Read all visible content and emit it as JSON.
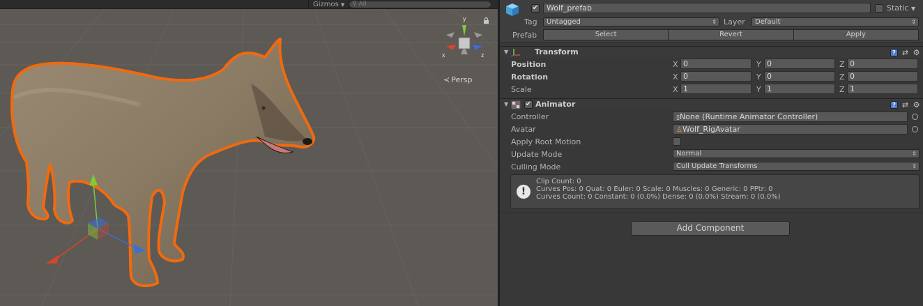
{
  "scene": {
    "gizmos_label": "Gizmos",
    "search_placeholder": "All",
    "persp_label": "Persp",
    "axis_x": "x",
    "axis_y": "y",
    "axis_z": "z"
  },
  "header": {
    "object_active": true,
    "object_name": "Wolf_prefab",
    "static_label": "Static",
    "tag_label": "Tag",
    "tag_value": "Untagged",
    "layer_label": "Layer",
    "layer_value": "Default",
    "prefab_label": "Prefab",
    "prefab_buttons": [
      "Select",
      "Revert",
      "Apply"
    ]
  },
  "transform": {
    "title": "Transform",
    "rows": [
      {
        "label": "Position",
        "x": "0",
        "y": "0",
        "z": "0"
      },
      {
        "label": "Rotation",
        "x": "0",
        "y": "0",
        "z": "0"
      },
      {
        "label": "Scale",
        "x": "1",
        "y": "1",
        "z": "1"
      }
    ],
    "axis_labels": [
      "X",
      "Y",
      "Z"
    ]
  },
  "animator": {
    "title": "Animator",
    "enabled": true,
    "controller_label": "Controller",
    "controller_value": "None (Runtime Animator Controller)",
    "avatar_label": "Avatar",
    "avatar_value": "Wolf_RigAvatar",
    "root_motion_label": "Apply Root Motion",
    "root_motion_checked": false,
    "update_mode_label": "Update Mode",
    "update_mode_value": "Normal",
    "culling_mode_label": "Culling Mode",
    "culling_mode_value": "Cull Update Transforms",
    "info_lines": [
      "Clip Count: 0",
      "Curves Pos: 0 Quat: 0 Euler: 0 Scale: 0 Muscles: 0 Generic: 0 PPtr: 0",
      "Curves Count: 0 Constant: 0 (0.0%) Dense: 0 (0.0%) Stream: 0 (0.0%)"
    ]
  },
  "add_component_label": "Add Component",
  "colors": {
    "selection_outline": "#f06a10",
    "scene_bg": "#5d5955",
    "inspector_bg": "#383838",
    "axis_x": "#d8452a",
    "axis_y": "#7fcb3a",
    "axis_z": "#3a6fd8"
  }
}
